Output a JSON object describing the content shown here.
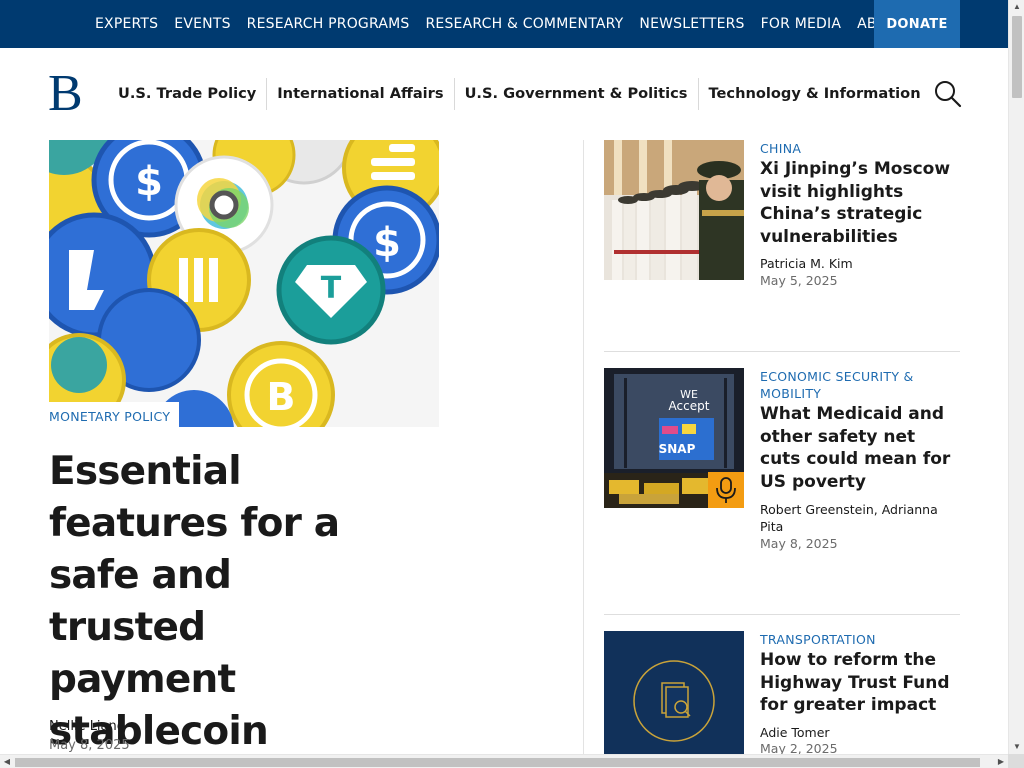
{
  "top_nav": {
    "items": [
      "EXPERTS",
      "EVENTS",
      "RESEARCH PROGRAMS",
      "RESEARCH & COMMENTARY",
      "NEWSLETTERS",
      "FOR MEDIA",
      "ABOUT US"
    ],
    "donate_label": "DONATE"
  },
  "header": {
    "logo_letter": "B",
    "topics": [
      "U.S. Trade Policy",
      "International Affairs",
      "U.S. Government & Politics",
      "Technology & Information"
    ]
  },
  "feature": {
    "category": "MONETARY POLICY",
    "title": "Essential features for a safe and trusted payment stablecoin",
    "author": "Nellie Liang",
    "date": "May 8, 2025"
  },
  "side_articles": [
    {
      "category": "CHINA",
      "title": "Xi Jinping’s Moscow visit highlights China’s strategic vulnerabilities",
      "author": "Patricia M. Kim",
      "date": "May 5, 2025"
    },
    {
      "category": "ECONOMIC SECURITY & MOBILITY",
      "title": "What Medicaid and other safety net cuts could mean for US poverty",
      "author": "Robert Greenstein, Adrianna Pita",
      "date": "May 8, 2025",
      "thumb_text_we": "WE",
      "thumb_text_accept": "Accept",
      "thumb_text_snap": "SNAP"
    },
    {
      "category": "TRANSPORTATION",
      "title": "How to reform the Highway Trust Fund for greater impact",
      "author": "Adie Tomer",
      "date": "May 2, 2025"
    }
  ],
  "colors": {
    "navy": "#003a70",
    "accent_blue": "#1e6bb0",
    "podcast_orange": "#f39c12"
  }
}
